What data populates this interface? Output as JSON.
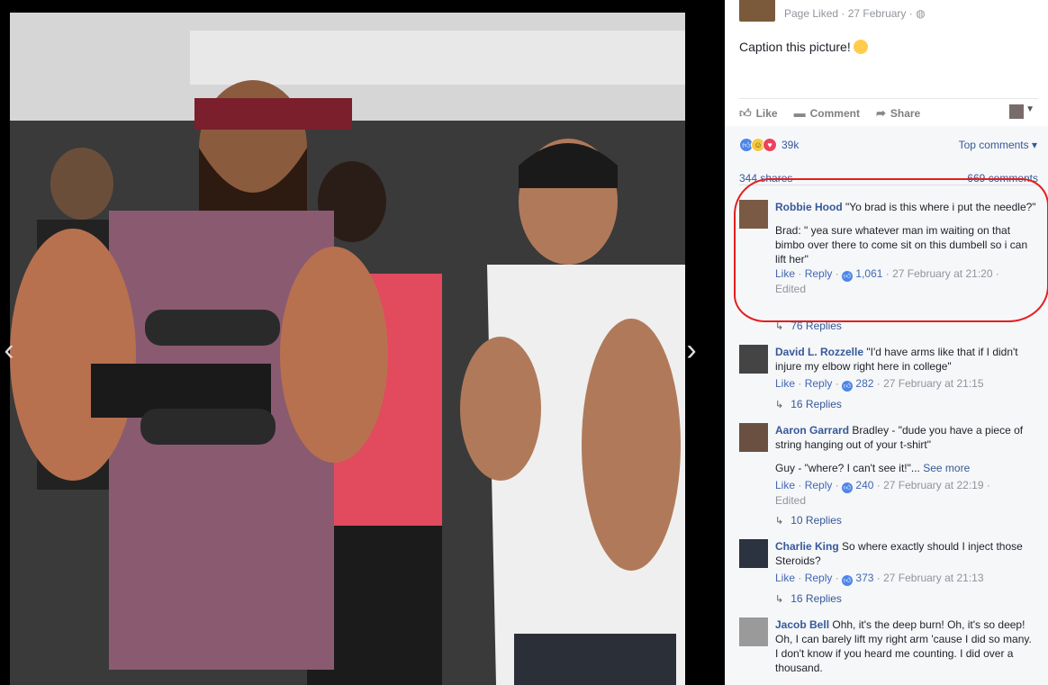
{
  "post": {
    "meta": "Page Liked · 27 February ·",
    "caption": "Caption this picture!",
    "actions": {
      "like": "Like",
      "comment": "Comment",
      "share": "Share"
    }
  },
  "reactions": {
    "count": "39k",
    "sort": "Top comments"
  },
  "counts": {
    "shares": "344 shares",
    "comments": "669 comments"
  },
  "comments": [
    {
      "name": "Robbie Hood",
      "text1": "\"Yo brad is this where i put the needle?\"",
      "text2": "Brad: \" yea sure whatever man im waiting on that bimbo over there to come sit on this dumbell so i can lift her\"",
      "like": "Like",
      "reply": "Reply",
      "likes": "1,061",
      "time": "27 February at 21:20",
      "edited": "Edited",
      "replies": "76 Replies"
    },
    {
      "name": "David L. Rozzelle",
      "text1": "\"I'd have arms like that if I didn't injure my elbow right here in college\"",
      "like": "Like",
      "reply": "Reply",
      "likes": "282",
      "time": "27 February at 21:15",
      "replies": "16 Replies"
    },
    {
      "name": "Aaron Garrard",
      "text1": "Bradley - \"dude you have a piece of string hanging out of your t-shirt\"",
      "text2": "Guy - \"where? I can't see it!\"...",
      "see_more": "See more",
      "like": "Like",
      "reply": "Reply",
      "likes": "240",
      "time": "27 February at 22:19",
      "edited": "Edited",
      "replies": "10 Replies"
    },
    {
      "name": "Charlie King",
      "text1": "So where exactly should I inject those Steroids?",
      "like": "Like",
      "reply": "Reply",
      "likes": "373",
      "time": "27 February at 21:13",
      "replies": "16 Replies"
    },
    {
      "name": "Jacob Bell",
      "text1": "Ohh, it's the deep burn! Oh, it's so deep! Oh, I can barely lift my right arm 'cause I did so many. I don't know if you heard me counting. I did over a thousand."
    }
  ],
  "colors": {
    "link": "#365899",
    "highlight": "#e41e1e",
    "like_blue": "#4d86e8"
  },
  "icons": [
    "chevron-left-icon",
    "chevron-right-icon",
    "like-icon",
    "comment-icon",
    "share-icon",
    "globe-icon",
    "reply-arrow-icon"
  ]
}
